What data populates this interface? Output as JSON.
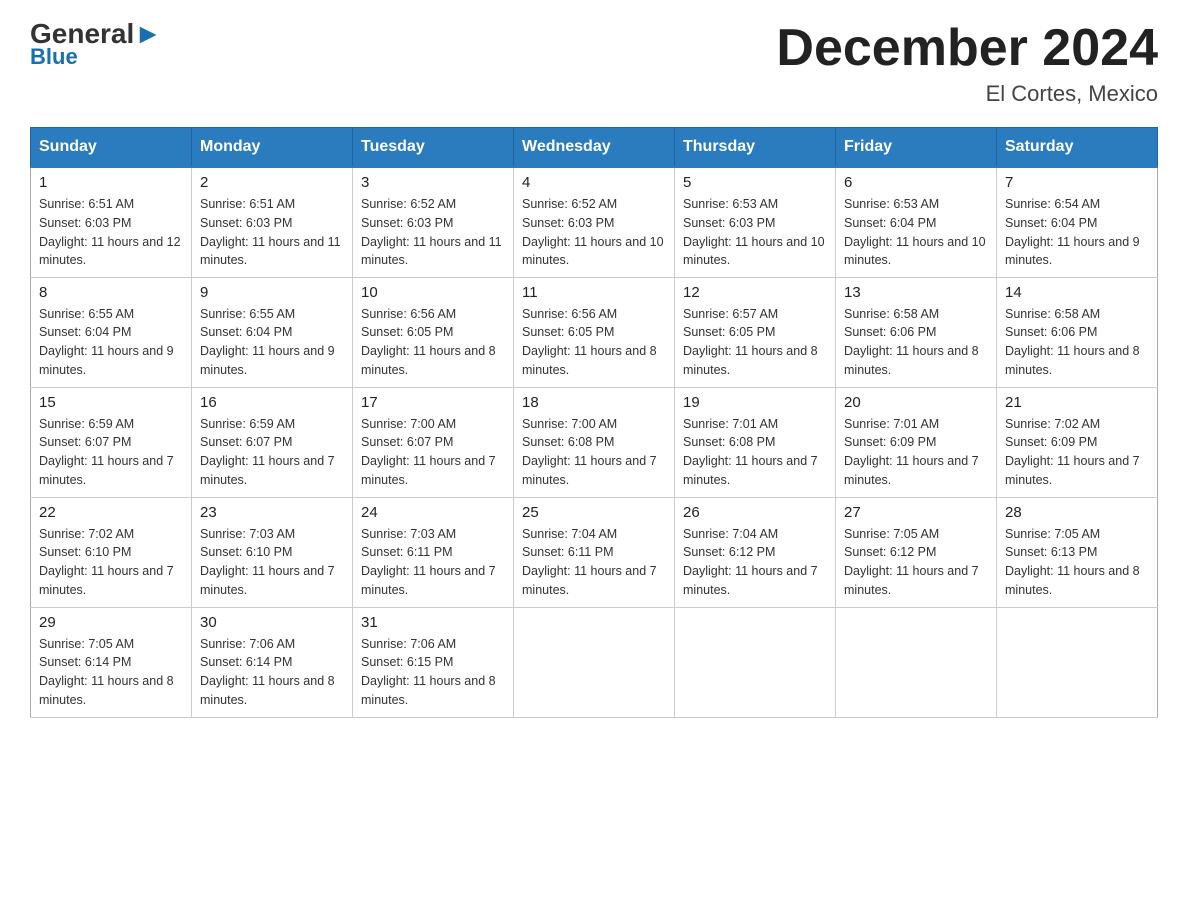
{
  "header": {
    "logo": {
      "general": "General",
      "blue": "Blue"
    },
    "title": "December 2024",
    "subtitle": "El Cortes, Mexico"
  },
  "calendar": {
    "days_of_week": [
      "Sunday",
      "Monday",
      "Tuesday",
      "Wednesday",
      "Thursday",
      "Friday",
      "Saturday"
    ],
    "weeks": [
      [
        {
          "day": 1,
          "sunrise": "6:51 AM",
          "sunset": "6:03 PM",
          "daylight": "11 hours and 12 minutes."
        },
        {
          "day": 2,
          "sunrise": "6:51 AM",
          "sunset": "6:03 PM",
          "daylight": "11 hours and 11 minutes."
        },
        {
          "day": 3,
          "sunrise": "6:52 AM",
          "sunset": "6:03 PM",
          "daylight": "11 hours and 11 minutes."
        },
        {
          "day": 4,
          "sunrise": "6:52 AM",
          "sunset": "6:03 PM",
          "daylight": "11 hours and 10 minutes."
        },
        {
          "day": 5,
          "sunrise": "6:53 AM",
          "sunset": "6:03 PM",
          "daylight": "11 hours and 10 minutes."
        },
        {
          "day": 6,
          "sunrise": "6:53 AM",
          "sunset": "6:04 PM",
          "daylight": "11 hours and 10 minutes."
        },
        {
          "day": 7,
          "sunrise": "6:54 AM",
          "sunset": "6:04 PM",
          "daylight": "11 hours and 9 minutes."
        }
      ],
      [
        {
          "day": 8,
          "sunrise": "6:55 AM",
          "sunset": "6:04 PM",
          "daylight": "11 hours and 9 minutes."
        },
        {
          "day": 9,
          "sunrise": "6:55 AM",
          "sunset": "6:04 PM",
          "daylight": "11 hours and 9 minutes."
        },
        {
          "day": 10,
          "sunrise": "6:56 AM",
          "sunset": "6:05 PM",
          "daylight": "11 hours and 8 minutes."
        },
        {
          "day": 11,
          "sunrise": "6:56 AM",
          "sunset": "6:05 PM",
          "daylight": "11 hours and 8 minutes."
        },
        {
          "day": 12,
          "sunrise": "6:57 AM",
          "sunset": "6:05 PM",
          "daylight": "11 hours and 8 minutes."
        },
        {
          "day": 13,
          "sunrise": "6:58 AM",
          "sunset": "6:06 PM",
          "daylight": "11 hours and 8 minutes."
        },
        {
          "day": 14,
          "sunrise": "6:58 AM",
          "sunset": "6:06 PM",
          "daylight": "11 hours and 8 minutes."
        }
      ],
      [
        {
          "day": 15,
          "sunrise": "6:59 AM",
          "sunset": "6:07 PM",
          "daylight": "11 hours and 7 minutes."
        },
        {
          "day": 16,
          "sunrise": "6:59 AM",
          "sunset": "6:07 PM",
          "daylight": "11 hours and 7 minutes."
        },
        {
          "day": 17,
          "sunrise": "7:00 AM",
          "sunset": "6:07 PM",
          "daylight": "11 hours and 7 minutes."
        },
        {
          "day": 18,
          "sunrise": "7:00 AM",
          "sunset": "6:08 PM",
          "daylight": "11 hours and 7 minutes."
        },
        {
          "day": 19,
          "sunrise": "7:01 AM",
          "sunset": "6:08 PM",
          "daylight": "11 hours and 7 minutes."
        },
        {
          "day": 20,
          "sunrise": "7:01 AM",
          "sunset": "6:09 PM",
          "daylight": "11 hours and 7 minutes."
        },
        {
          "day": 21,
          "sunrise": "7:02 AM",
          "sunset": "6:09 PM",
          "daylight": "11 hours and 7 minutes."
        }
      ],
      [
        {
          "day": 22,
          "sunrise": "7:02 AM",
          "sunset": "6:10 PM",
          "daylight": "11 hours and 7 minutes."
        },
        {
          "day": 23,
          "sunrise": "7:03 AM",
          "sunset": "6:10 PM",
          "daylight": "11 hours and 7 minutes."
        },
        {
          "day": 24,
          "sunrise": "7:03 AM",
          "sunset": "6:11 PM",
          "daylight": "11 hours and 7 minutes."
        },
        {
          "day": 25,
          "sunrise": "7:04 AM",
          "sunset": "6:11 PM",
          "daylight": "11 hours and 7 minutes."
        },
        {
          "day": 26,
          "sunrise": "7:04 AM",
          "sunset": "6:12 PM",
          "daylight": "11 hours and 7 minutes."
        },
        {
          "day": 27,
          "sunrise": "7:05 AM",
          "sunset": "6:12 PM",
          "daylight": "11 hours and 7 minutes."
        },
        {
          "day": 28,
          "sunrise": "7:05 AM",
          "sunset": "6:13 PM",
          "daylight": "11 hours and 8 minutes."
        }
      ],
      [
        {
          "day": 29,
          "sunrise": "7:05 AM",
          "sunset": "6:14 PM",
          "daylight": "11 hours and 8 minutes."
        },
        {
          "day": 30,
          "sunrise": "7:06 AM",
          "sunset": "6:14 PM",
          "daylight": "11 hours and 8 minutes."
        },
        {
          "day": 31,
          "sunrise": "7:06 AM",
          "sunset": "6:15 PM",
          "daylight": "11 hours and 8 minutes."
        },
        null,
        null,
        null,
        null
      ]
    ]
  }
}
